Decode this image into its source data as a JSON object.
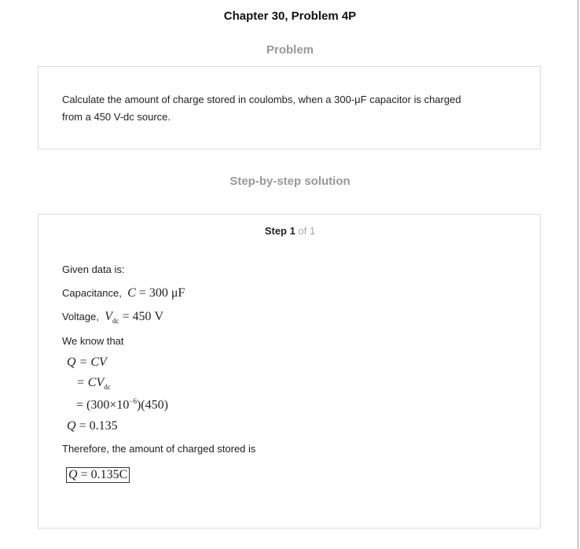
{
  "header": {
    "title": "Chapter 30, Problem 4P"
  },
  "problem": {
    "heading": "Problem",
    "text_line1": "Calculate the amount of charge stored in coulombs, when a 300-μF capacitor is charged",
    "text_line2": "from a 450 V-dc source."
  },
  "solution": {
    "heading": "Step-by-step solution",
    "step_label": "Step 1",
    "step_of": "of 1",
    "given": "Given data is:",
    "cap_label": "Capacitance,",
    "cap_eq": "= 300 μF",
    "volt_label": "Voltage,",
    "volt_eq": "= 450 V",
    "know": "We know that",
    "eq1": "= CV",
    "eq2": "= CV",
    "eq3": "= (300×10",
    "eq3_exp": "−6",
    "eq3_end": ")(450)",
    "eq4": "= 0.135",
    "therefore": "Therefore, the amount of charged stored is",
    "answer": "= 0.135C",
    "sym_Q": "Q",
    "sym_C": "C",
    "sym_V": "V",
    "sub_dc": "dc"
  }
}
